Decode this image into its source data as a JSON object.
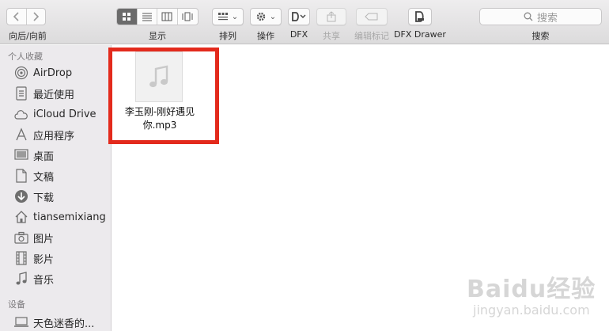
{
  "toolbar": {
    "nav_label": "向后/向前",
    "view_label": "显示",
    "arrange_label": "排列",
    "action_label": "操作",
    "dfx_label": "DFX",
    "share_label": "共享",
    "tags_label": "编辑标记",
    "dfx_drawer_label": "DFX Drawer",
    "search_label": "搜索",
    "search_placeholder": "搜索"
  },
  "sidebar": {
    "favorites_header": "个人收藏",
    "devices_header": "设备",
    "items": [
      {
        "label": "AirDrop",
        "icon": "airdrop-icon"
      },
      {
        "label": "最近使用",
        "icon": "recents-icon"
      },
      {
        "label": "iCloud Drive",
        "icon": "cloud-icon"
      },
      {
        "label": "应用程序",
        "icon": "applications-icon"
      },
      {
        "label": "桌面",
        "icon": "desktop-icon"
      },
      {
        "label": "文稿",
        "icon": "documents-icon"
      },
      {
        "label": "下载",
        "icon": "download-icon"
      },
      {
        "label": "tiansemixiang",
        "icon": "home-icon"
      },
      {
        "label": "图片",
        "icon": "camera-icon"
      },
      {
        "label": "影片",
        "icon": "film-icon"
      },
      {
        "label": "音乐",
        "icon": "music-icon"
      }
    ],
    "devices": [
      {
        "label": "天色迷香的...",
        "icon": "laptop-icon"
      }
    ]
  },
  "main": {
    "file": {
      "name": "李玉刚-刚好遇见你.mp3",
      "icon": "music-file-icon"
    }
  },
  "watermark": {
    "text": "Baidu经验",
    "url": "jingyan.baidu.com"
  },
  "colors": {
    "highlight": "#e32a1c",
    "sidebar_bg": "#eceaed",
    "toolbar_bg": "#e4e3e4"
  }
}
